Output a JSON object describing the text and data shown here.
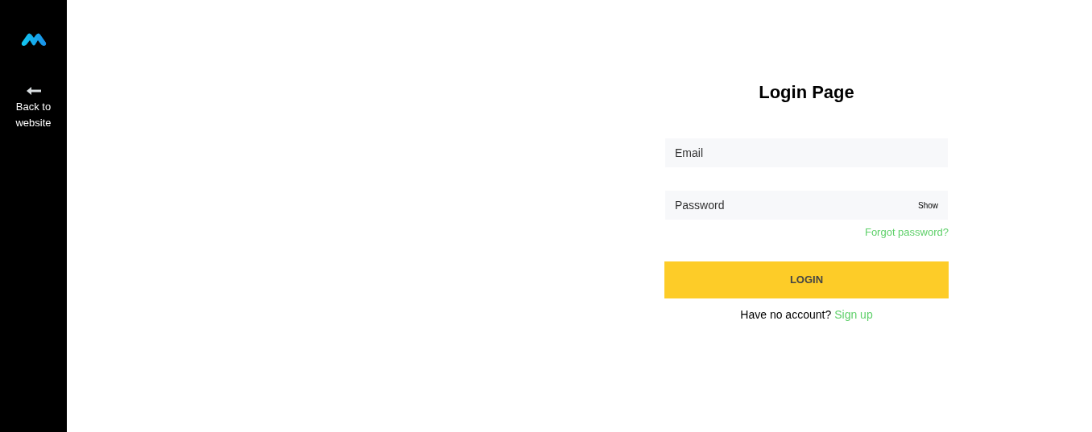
{
  "sidebar": {
    "back_link": {
      "label": "Back to website"
    }
  },
  "login": {
    "title": "Login Page",
    "email": {
      "placeholder": "Email"
    },
    "password": {
      "placeholder": "Password",
      "toggle": "Show"
    },
    "forgot_link": "Forgot password?",
    "submit": "LOGIN",
    "signup_prompt": "Have no account?",
    "signup_link": "Sign up"
  }
}
